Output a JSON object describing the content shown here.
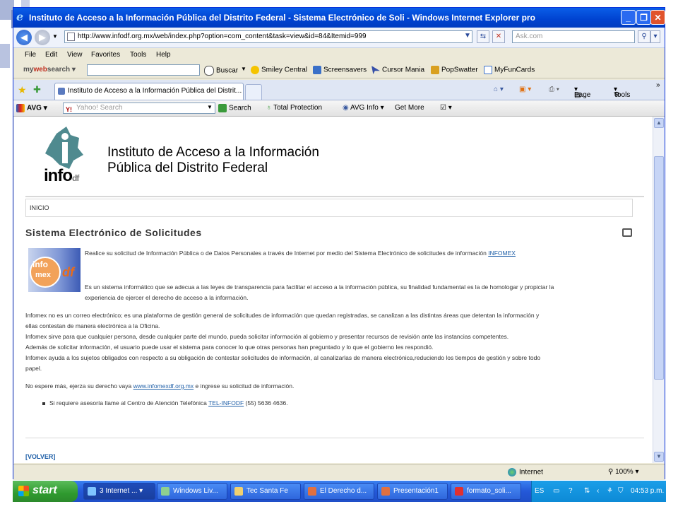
{
  "window": {
    "title": "Instituto de Acceso a la Información Pública del Distrito Federal - Sistema Electrónico de Soli - Windows Internet Explorer pro"
  },
  "address_bar": {
    "url": "http://www.infodf.org.mx/web/index.php?option=com_content&task=view&id=84&Itemid=999",
    "search_placeholder": "Ask.com"
  },
  "menu": [
    "File",
    "Edit",
    "View",
    "Favorites",
    "Tools",
    "Help"
  ],
  "mywebsearch": {
    "brand_my": "my",
    "brand_web": "web",
    "brand_search": "search",
    "buscar": "Buscar",
    "links": [
      "Smiley Central",
      "Screensavers",
      "Cursor Mania",
      "PopSwatter",
      "MyFunCards"
    ]
  },
  "tab": {
    "label": "Instituto de Acceso a la Información Pública del Distrit...",
    "tools": [
      "Page",
      "Tools"
    ]
  },
  "avg": {
    "brand": "AVG",
    "search_placeholder": "Yahoo! Search",
    "search_label": "Search",
    "total_protection": "Total Protection",
    "info": "AVG Info",
    "get_more": "Get More"
  },
  "page": {
    "logo_main": "info",
    "logo_sub": "df",
    "org_line1": "Instituto de Acceso a la Información",
    "org_line2": "Pública del Distrito Federal",
    "breadcrumb": "INICIO",
    "heading": "Sistema Electrónico de Solicitudes",
    "infomex_logo": {
      "info": "info",
      "mex": "mex",
      "df": "df"
    },
    "intro": "Realice su solicitud de Información Pública o de Datos Personales a través de Internet por medio del Sistema Electrónico de solicitudes de información",
    "intro_link": "INFOMEX",
    "desc_1": "Es un sistema informático que se adecua a las leyes de transparencia para facilitar el acceso a la información pública, su finalidad fundamental es la de homologar y propiciar la",
    "desc_2": "experiencia de ejercer el derecho de acceso a la información.",
    "para1_1": "Infomex no es un correo electrónico; es una plataforma de gestión general de solicitudes de información que quedan registradas, se canalizan a las distintas áreas que detentan la información y",
    "para1_2": "ellas contestan de manera electrónica a la Oficina.",
    "para2": "Infomex sirve para que cualquier persona, desde cualquier parte del mundo, pueda solicitar información al gobierno y presentar recursos de revisión ante las instancias competentes.",
    "para3": "Además de solicitar información, el usuario puede usar el sistema para conocer lo que otras personas han preguntado y lo que el gobierno les respondió.",
    "para4_1": "Infomex ayuda a los sujetos obligados con respecto a su obligación de contestar solicitudes de información, al canalizarlas de manera electrónica,reduciendo los tiempos de gestión y sobre todo",
    "para4_2": "papel.",
    "cta_pre": "No espere más, ejerza su derecho vaya",
    "cta_link": "www.infomexdf.org.mx",
    "cta_post": "e ingrese su solicitud de información.",
    "bullet_pre": "Si requiere asesoría llame al Centro de Atención Telefónica",
    "bullet_link": "TEL-INFODF",
    "bullet_post": "(55) 5636 4636.",
    "volver": "[VOLVER]"
  },
  "status": {
    "zone": "Internet",
    "zoom": "100%"
  },
  "taskbar": {
    "start": "start",
    "buttons": [
      {
        "label": "3 Internet ..."
      },
      {
        "label": "Windows Liv..."
      },
      {
        "label": "Tec Santa Fe"
      },
      {
        "label": "El Derecho d..."
      },
      {
        "label": "Presentación1"
      },
      {
        "label": "formato_soli..."
      }
    ],
    "lang": "ES",
    "clock": "04:53 p.m."
  },
  "colors": {
    "titlebar": "#0042d0",
    "link": "#2060a8",
    "start": "#2f9a2f",
    "taskbar": "#2458d8"
  }
}
